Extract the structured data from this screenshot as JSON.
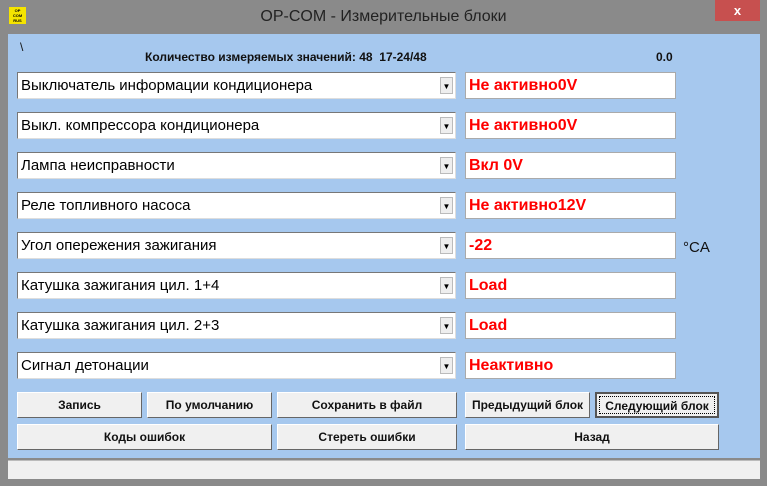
{
  "window": {
    "title": "OP-COM - Измерительные блоки",
    "logo_text": "OP COM RUS",
    "close": "x"
  },
  "header": {
    "path": "\\",
    "count_label": "Количество измеряемых значений: 48  17-24/48",
    "value": "0.0"
  },
  "rows": [
    {
      "label": "Выключатель информации кондиционера",
      "value": "Не активно0V",
      "unit": ""
    },
    {
      "label": "Выкл. компрессора кондиционера",
      "value": "Не активно0V",
      "unit": ""
    },
    {
      "label": "Лампа неисправности",
      "value": "Вкл  0V",
      "unit": ""
    },
    {
      "label": "Реле топливного насоса",
      "value": "Не активно12V",
      "unit": ""
    },
    {
      "label": "Угол опережения зажигания",
      "value": "-22",
      "unit": "°CA"
    },
    {
      "label": "Катушка зажигания цил. 1+4",
      "value": "Load",
      "unit": ""
    },
    {
      "label": "Катушка зажигания цил. 2+3",
      "value": "Load",
      "unit": ""
    },
    {
      "label": "Сигнал детонации",
      "value": "Неактивно",
      "unit": ""
    }
  ],
  "buttons": {
    "record": "Запись",
    "default": "По умолчанию",
    "save": "Сохранить в файл",
    "prev": "Предыдущий блок",
    "next": "Следующий блок",
    "codes": "Коды ошибок",
    "clear": "Стереть ошибки",
    "back": "Назад"
  },
  "colors": {
    "background": "#a6c8ee",
    "value_text": "#ff0000"
  }
}
